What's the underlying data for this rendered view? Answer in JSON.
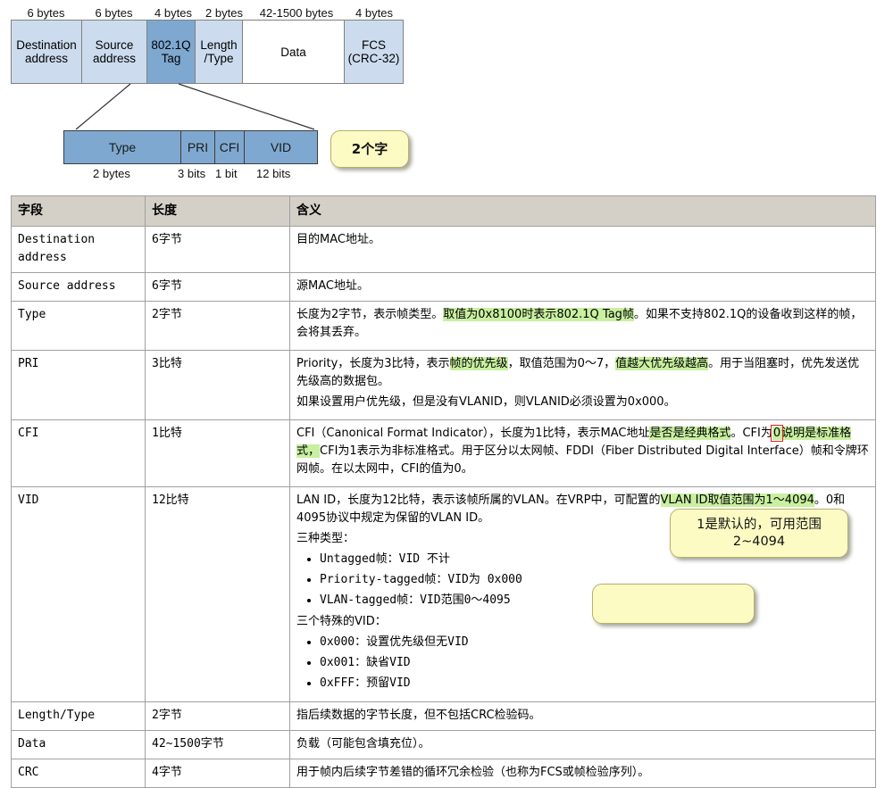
{
  "frame_diagram": {
    "byte_labels": [
      "6 bytes",
      "6 bytes",
      "4 bytes",
      "2 bytes",
      "42-1500 bytes",
      "4 bytes"
    ],
    "cells": [
      {
        "label": "Destination address",
        "style": "light"
      },
      {
        "label": "Source address",
        "style": "light"
      },
      {
        "label": "802.1Q Tag",
        "style": "accent"
      },
      {
        "label": "Length /Type",
        "style": "light"
      },
      {
        "label": "Data",
        "style": "plain"
      },
      {
        "label": "FCS (CRC-32)",
        "style": "light"
      }
    ]
  },
  "tag_diagram": {
    "cells": [
      "Type",
      "PRI",
      "CFI",
      "VID"
    ],
    "sublabels": [
      "2 bytes",
      "3 bits",
      "1 bit",
      "12 bits"
    ]
  },
  "callouts": {
    "two_char": "2个字",
    "vid_note": "1是默认的，可用范围2~4094",
    "empty_note": ""
  },
  "table": {
    "headers": [
      "字段",
      "长度",
      "含义"
    ],
    "rows": [
      {
        "field": "Destination address",
        "length": "6字节",
        "meaning_plain": "目的MAC地址。"
      },
      {
        "field": "Source address",
        "length": "6字节",
        "meaning_plain": "源MAC地址。"
      },
      {
        "field": "Type",
        "length": "2字节",
        "meaning_parts": {
          "p1a": "长度为2字节，表示帧类型。",
          "p1_hl": "取值为0x8100时表示802.1Q Tag帧",
          "p1b": "。如果不支持802.1Q的设备收到这样的帧，会将其丢弃。"
        }
      },
      {
        "field": "PRI",
        "length": "3比特",
        "meaning_parts": {
          "p1a": "Priority，长度为3比特，表示",
          "p1_hl1": "帧的优先级",
          "p1b": "，取值范围为0～7，",
          "p1_hl2": "值越大优先级越高",
          "p1c": "。用于当阻塞时，优先发送优先级高的数据包。",
          "p2": "如果设置用户优先级，但是没有VLANID，则VLANID必须设置为0x000。"
        }
      },
      {
        "field": "CFI",
        "length": "1比特",
        "meaning_parts": {
          "p1a": "CFI（Canonical Format Indicator），长度为1比特，表示MAC地址",
          "p1_hl1": "是否是经典格式",
          "p1b": "。CFI为",
          "p1_red": "0",
          "p1_hl2": "说明是标准格式，",
          "p1c": "CFI为1表示为非标准格式。用于区分以太网帧、FDDI（Fiber Distributed Digital Interface）帧和令牌环网帧。在以太网中，CFI的值为0。"
        }
      },
      {
        "field": "VID",
        "length": "12比特",
        "meaning_parts": {
          "p1a": "LAN ID，长度为12比特，表示该帧所属的VLAN。在VRP中，可配置的",
          "p1_hl": "VLAN ID取值范围为1～4094",
          "p1b": "。0和4095协议中规定为保留的VLAN ID。",
          "p2": "三种类型：",
          "list1": [
            "Untagged帧：VID 不计",
            "Priority-tagged帧：VID为 0x000",
            "VLAN-tagged帧：VID范围0～4095"
          ],
          "p3": "三个特殊的VID：",
          "list2": [
            "0x000：设置优先级但无VID",
            "0x001：缺省VID",
            "0xFFF：预留VID"
          ]
        }
      },
      {
        "field": "Length/Type",
        "length": "2字节",
        "meaning_plain": "指后续数据的字节长度，但不包括CRC检验码。"
      },
      {
        "field": "Data",
        "length": "42~1500字节",
        "meaning_plain": "负载（可能包含填充位）。"
      },
      {
        "field": "CRC",
        "length": "4字节",
        "meaning_plain": "用于帧内后续字节差错的循环冗余检验（也称为FCS或帧检验序列）。"
      }
    ]
  },
  "colors": {
    "frame_light": "#ccdcee",
    "frame_accent": "#7fa8d0",
    "highlight": "#c8f0a0",
    "redbox": "#e02020",
    "callout_bg": "#fdfbc4",
    "header_bg": "#d4d0c8"
  }
}
